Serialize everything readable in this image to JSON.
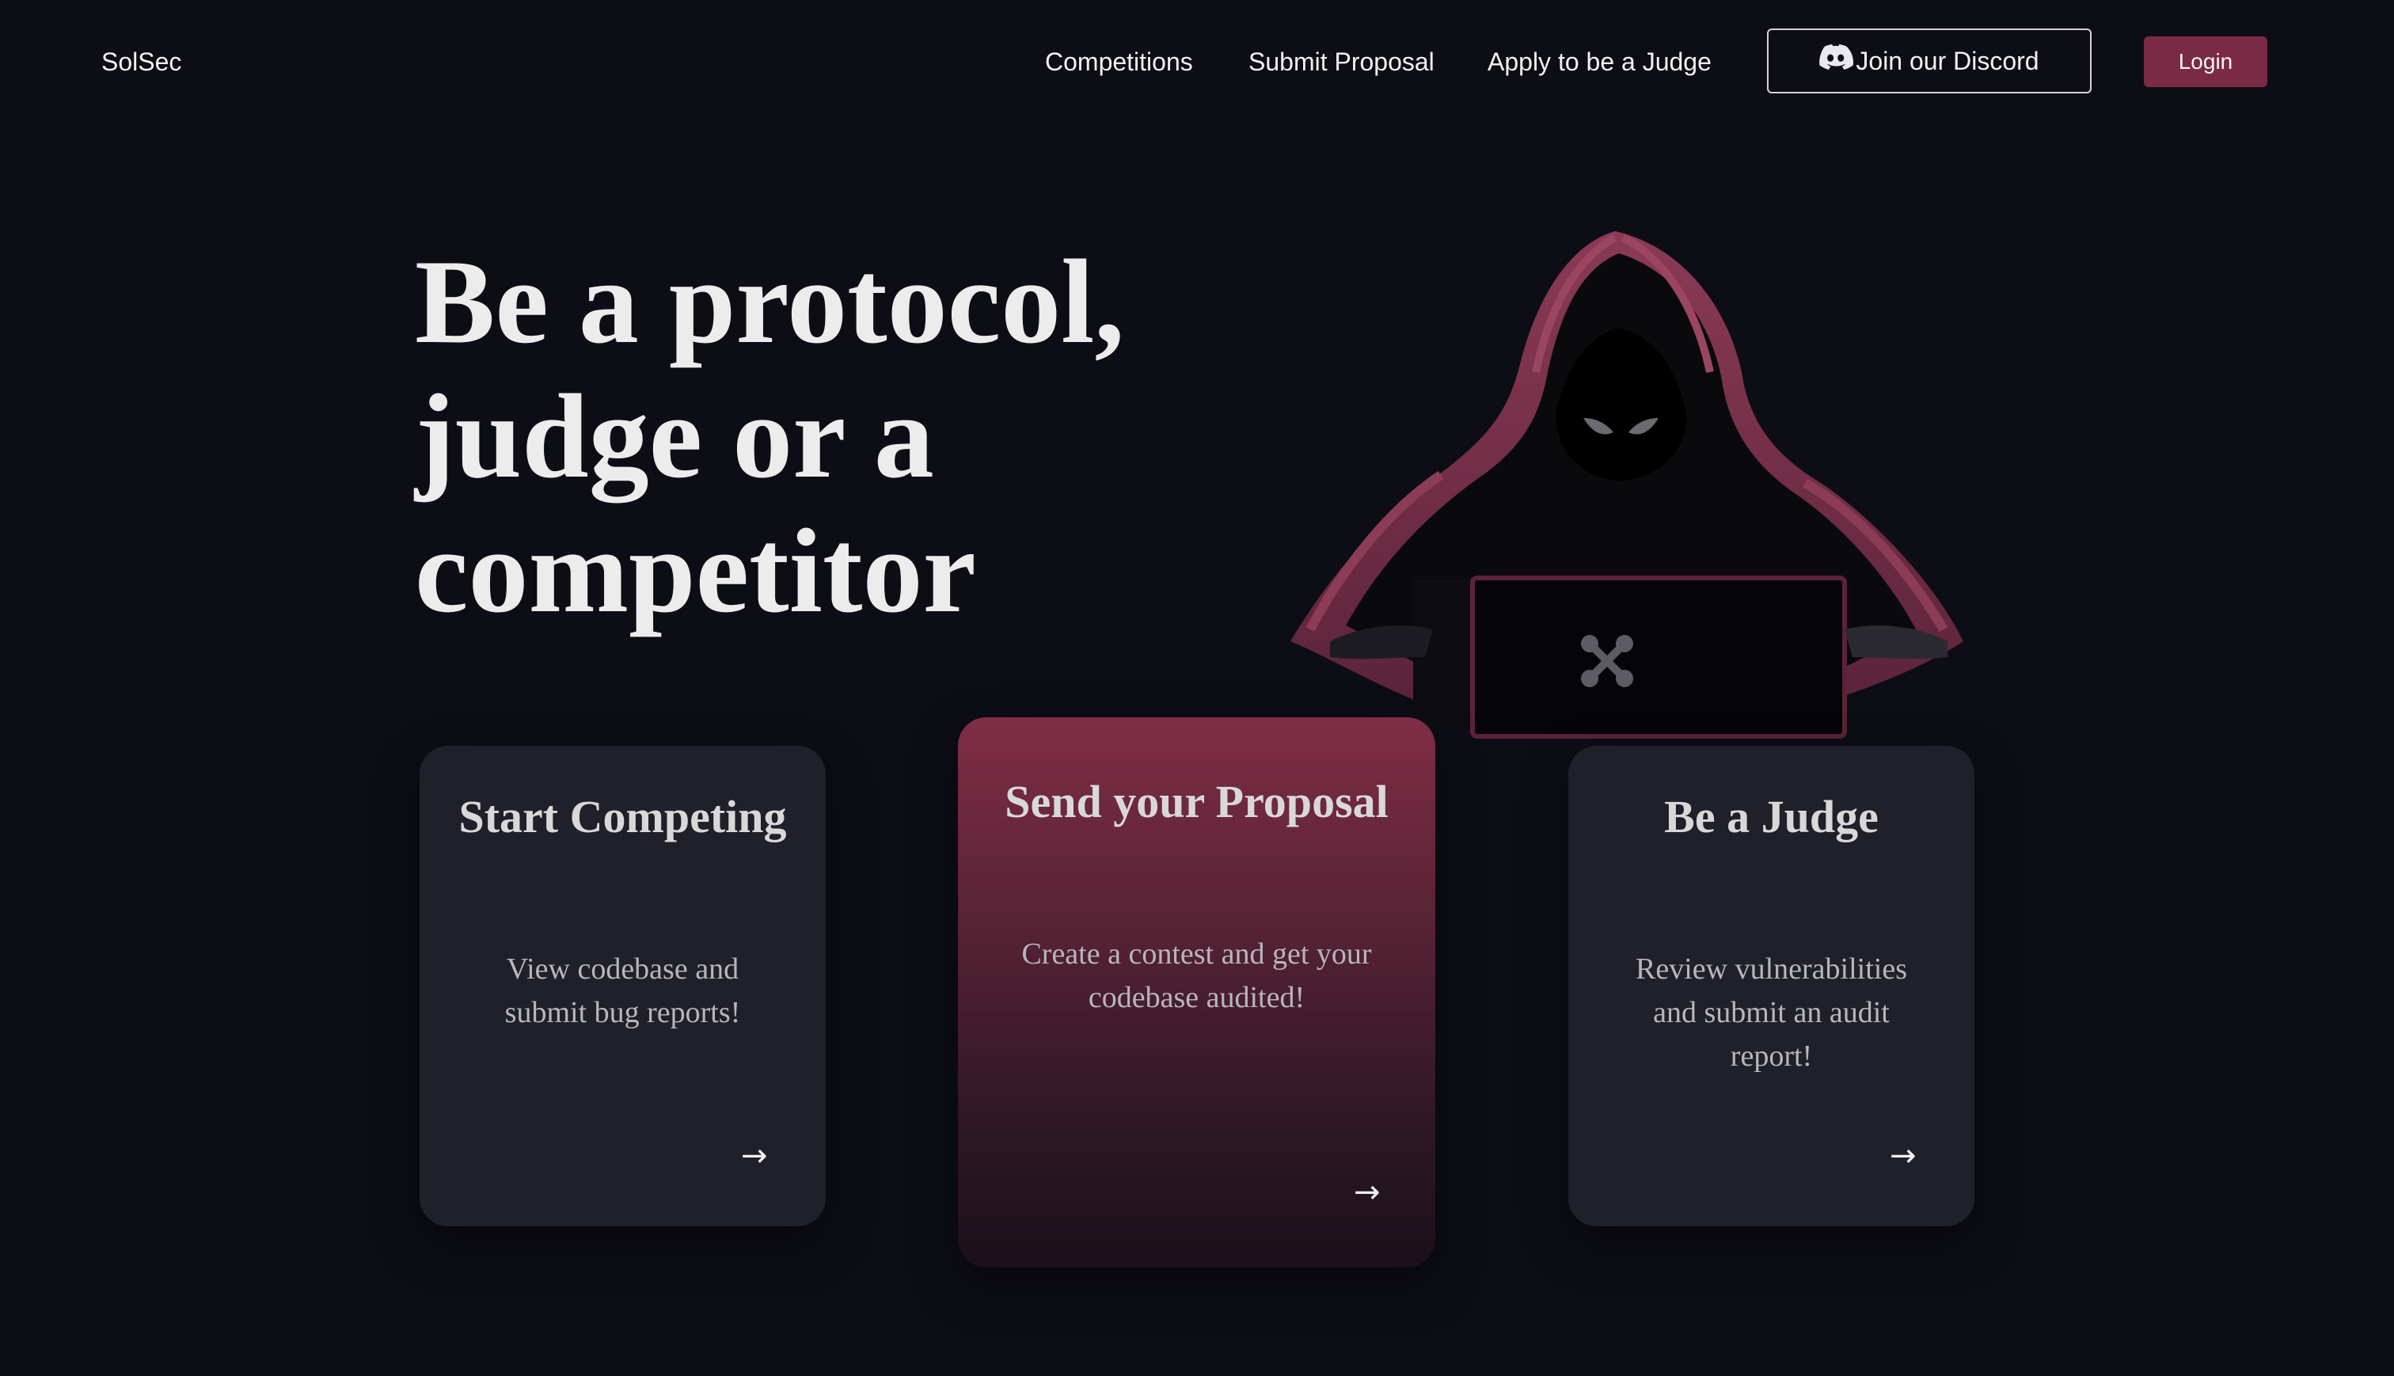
{
  "nav": {
    "brand": "SolSec",
    "links": [
      "Competitions",
      "Submit Proposal",
      "Apply to be a Judge"
    ],
    "discord_label": "Join our Discord",
    "login_label": "Login"
  },
  "hero": {
    "title_lines": [
      "Be a protocol,",
      "judge or a",
      "competitor"
    ]
  },
  "cards": [
    {
      "title": "Start Competing",
      "description": "View codebase and submit bug reports!",
      "arrow": "→",
      "style": "dark"
    },
    {
      "title": "Send your Proposal",
      "description": "Create a contest and get your codebase audited!",
      "arrow": "→",
      "style": "accent"
    },
    {
      "title": "Be a Judge",
      "description": "Review vulnerabilities and submit an audit report!",
      "arrow": "→",
      "style": "dark"
    }
  ],
  "colors": {
    "background": "#0d0d16",
    "accent": "#7a2a44",
    "card": "#20202a"
  },
  "icons": {
    "discord": "discord-icon",
    "arrow": "arrow-right-icon",
    "hero_image": "hooded-hacker-illustration"
  }
}
